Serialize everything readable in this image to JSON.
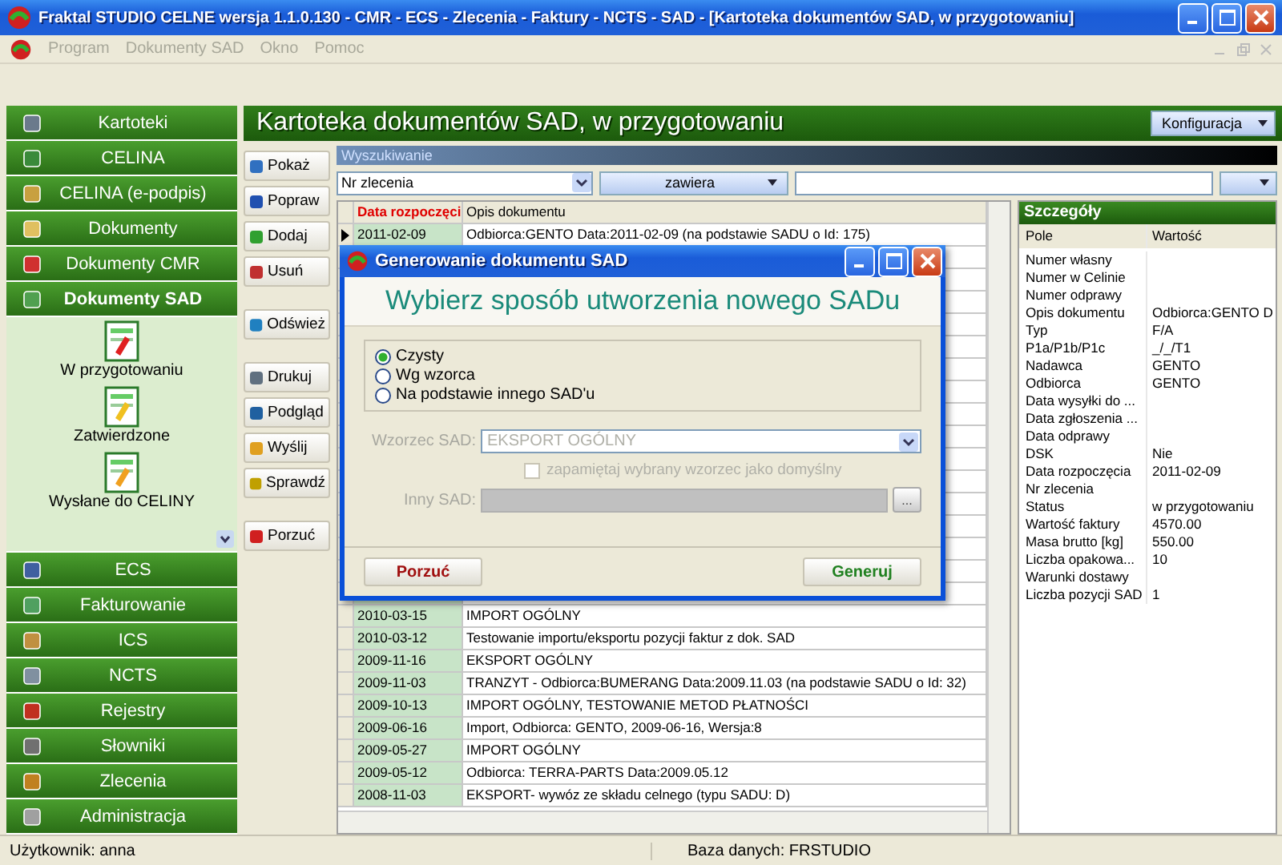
{
  "window": {
    "title": "Fraktal STUDIO CELNE  wersja 1.1.0.130 - CMR - ECS - Zlecenia - Faktury - NCTS - SAD - [Kartoteka dokumentów SAD, w przygotowaniu]"
  },
  "menu": [
    "Program",
    "Dokumenty SAD",
    "Okno",
    "Pomoc"
  ],
  "sidebar": {
    "groups": [
      {
        "label": "Kartoteki",
        "expanded": false
      },
      {
        "label": "CELINA",
        "expanded": false
      },
      {
        "label": "CELINA (e-podpis)",
        "expanded": false
      },
      {
        "label": "Dokumenty",
        "expanded": false
      },
      {
        "label": "Dokumenty CMR",
        "expanded": false
      },
      {
        "label": "Dokumenty SAD",
        "expanded": true,
        "items": [
          "W przygotowaniu",
          "Zatwierdzone",
          "Wysłane do CELINY"
        ]
      },
      {
        "label": "ECS",
        "expanded": false
      },
      {
        "label": "Fakturowanie",
        "expanded": false
      },
      {
        "label": "ICS",
        "expanded": false
      },
      {
        "label": "NCTS",
        "expanded": false
      },
      {
        "label": "Rejestry",
        "expanded": false
      },
      {
        "label": "Słowniki",
        "expanded": false
      },
      {
        "label": "Zlecenia",
        "expanded": false
      },
      {
        "label": "Administracja",
        "expanded": false
      }
    ]
  },
  "page": {
    "title": "Kartoteka dokumentów SAD, w przygotowaniu",
    "config_button": "Konfiguracja"
  },
  "actions": [
    [
      "Pokaż",
      "Popraw",
      "Dodaj",
      "Usuń"
    ],
    [
      "Odśwież"
    ],
    [
      "Drukuj",
      "Podgląd",
      "Wyślij",
      "Sprawdź"
    ],
    [
      "Porzuć"
    ]
  ],
  "search": {
    "title": "Wyszukiwanie",
    "field": "Nr zlecenia",
    "operator": "zawiera"
  },
  "table": {
    "columns": [
      {
        "label": "Data rozpoczęci",
        "sorted": true
      },
      {
        "label": "Opis dokumentu",
        "sorted": false
      }
    ],
    "rows_above_dialog": [
      {
        "date": "2011-02-09",
        "description": "Odbiorca:GENTO Data:2011-02-09 (na podstawie SADU o Id: 175)",
        "current": true
      }
    ],
    "rows_below_dialog": [
      {
        "date": "2010-03-15",
        "description": "IMPORT OGÓLNY",
        "current": false
      },
      {
        "date": "2010-03-12",
        "description": "Testowanie importu/eksportu pozycji faktur z dok. SAD",
        "current": false
      },
      {
        "date": "2009-11-16",
        "description": "EKSPORT OGÓLNY",
        "current": false
      },
      {
        "date": "2009-11-03",
        "description": "TRANZYT - Odbiorca:BUMERANG Data:2009.11.03 (na podstawie SADU o Id: 32)",
        "current": false
      },
      {
        "date": "2009-10-13",
        "description": "IMPORT OGÓLNY, TESTOWANIE METOD PŁATNOŚCI",
        "current": false
      },
      {
        "date": "2009-06-16",
        "description": "Import, Odbiorca: GENTO, 2009-06-16, Wersja:8",
        "current": false
      },
      {
        "date": "2009-05-27",
        "description": "IMPORT OGÓLNY",
        "current": false
      },
      {
        "date": "2009-05-12",
        "description": "Odbiorca: TERRA-PARTS Data:2009.05.12",
        "current": false
      },
      {
        "date": "2008-11-03",
        "description": "EKSPORT- wywóz ze składu celnego (typu SADU: D)",
        "current": false
      }
    ]
  },
  "details": {
    "title": "Szczegóły",
    "columns": [
      "Pole",
      "Wartość"
    ],
    "rows": [
      {
        "field": "Numer własny"
      },
      {
        "field": "Numer w Celinie"
      },
      {
        "field": "Numer odprawy"
      },
      {
        "field": "Opis dokumentu",
        "value": "Odbiorca:GENTO D"
      },
      {
        "field": "Typ",
        "value": "F/A"
      },
      {
        "field": "P1a/P1b/P1c",
        "value": "_/_/T1"
      },
      {
        "field": "Nadawca",
        "value": "GENTO"
      },
      {
        "field": "Odbiorca",
        "value": "GENTO"
      },
      {
        "field": "Data wysyłki do ..."
      },
      {
        "field": "Data zgłoszenia ..."
      },
      {
        "field": "Data odprawy"
      },
      {
        "field": "DSK",
        "value": "Nie"
      },
      {
        "field": "Data rozpoczęcia",
        "value": "2011-02-09"
      },
      {
        "field": "Nr zlecenia"
      },
      {
        "field": "Status",
        "value": "w przygotowaniu"
      },
      {
        "field": "Wartość faktury",
        "value": "4570.00"
      },
      {
        "field": "Masa brutto [kg]",
        "value": "550.00"
      },
      {
        "field": "Liczba opakowa...",
        "value": "10"
      },
      {
        "field": "Warunki dostawy"
      },
      {
        "field": "Liczba pozycji SAD",
        "value": "1"
      }
    ]
  },
  "dialog": {
    "title": "Generowanie dokumentu SAD",
    "heading": "Wybierz sposób utworzenia nowego SADu",
    "options": [
      {
        "label": "Czysty",
        "selected": true
      },
      {
        "label": "Wg wzorca",
        "selected": false
      },
      {
        "label": "Na podstawie innego SAD'u",
        "selected": false
      }
    ],
    "template": {
      "label": "Wzorzec SAD:",
      "value": "EKSPORT OGÓLNY",
      "disabled": true
    },
    "remember": {
      "label": "zapamiętaj wybrany wzorzec jako domyślny",
      "checked": false,
      "disabled": true
    },
    "other": {
      "label": "Inny SAD:",
      "button": "...",
      "disabled": true
    },
    "cancel_button": "Porzuć",
    "generate_button": "Generuj"
  },
  "status_bar": {
    "user": "Użytkownik: anna",
    "database": "Baza danych: FRSTUDIO"
  }
}
